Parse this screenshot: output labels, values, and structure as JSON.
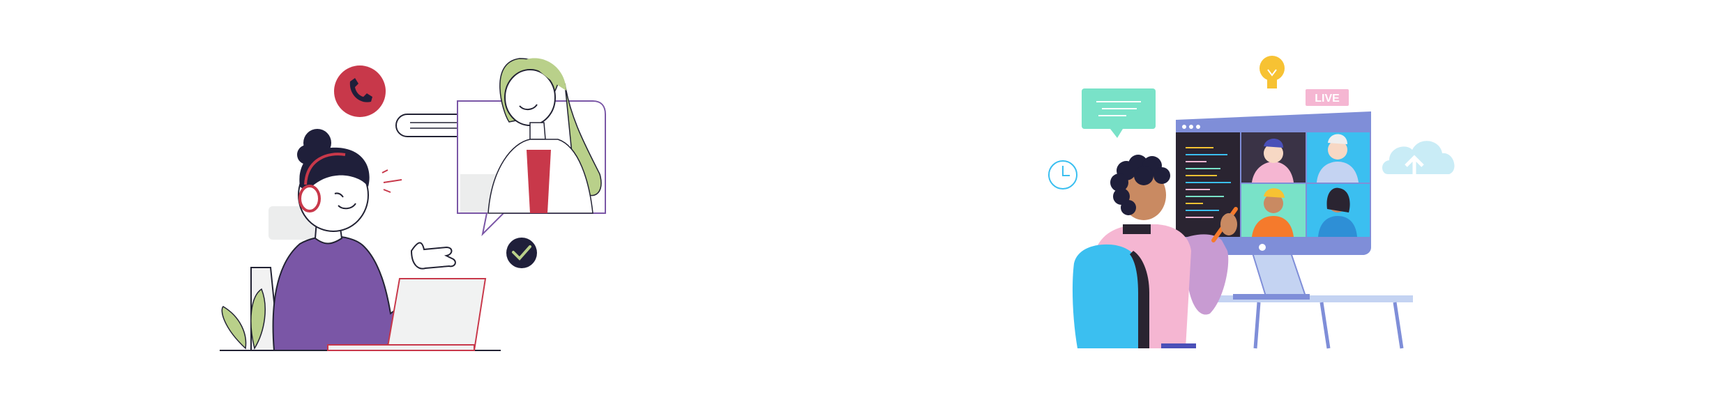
{
  "illustrations": [
    {
      "id": "customer-support-call",
      "icons": [
        "phone-icon",
        "checkmark-icon"
      ],
      "colors": {
        "accent_red": "#c8384a",
        "purple": "#7a56a6",
        "hair": "#1f1f3a",
        "green_hair": "#b9d08a",
        "outline": "#222233"
      }
    },
    {
      "id": "video-conference",
      "live_label": "LIVE",
      "icons": [
        "lightbulb-icon",
        "clock-icon",
        "cloud-upload-icon",
        "chat-bubble-icon"
      ],
      "colors": {
        "monitor": "#7f8ed8",
        "mint": "#79e2c8",
        "pink": "#f5b6d2",
        "blue_chair": "#3bbff0",
        "yellow": "#f7c233"
      }
    }
  ]
}
